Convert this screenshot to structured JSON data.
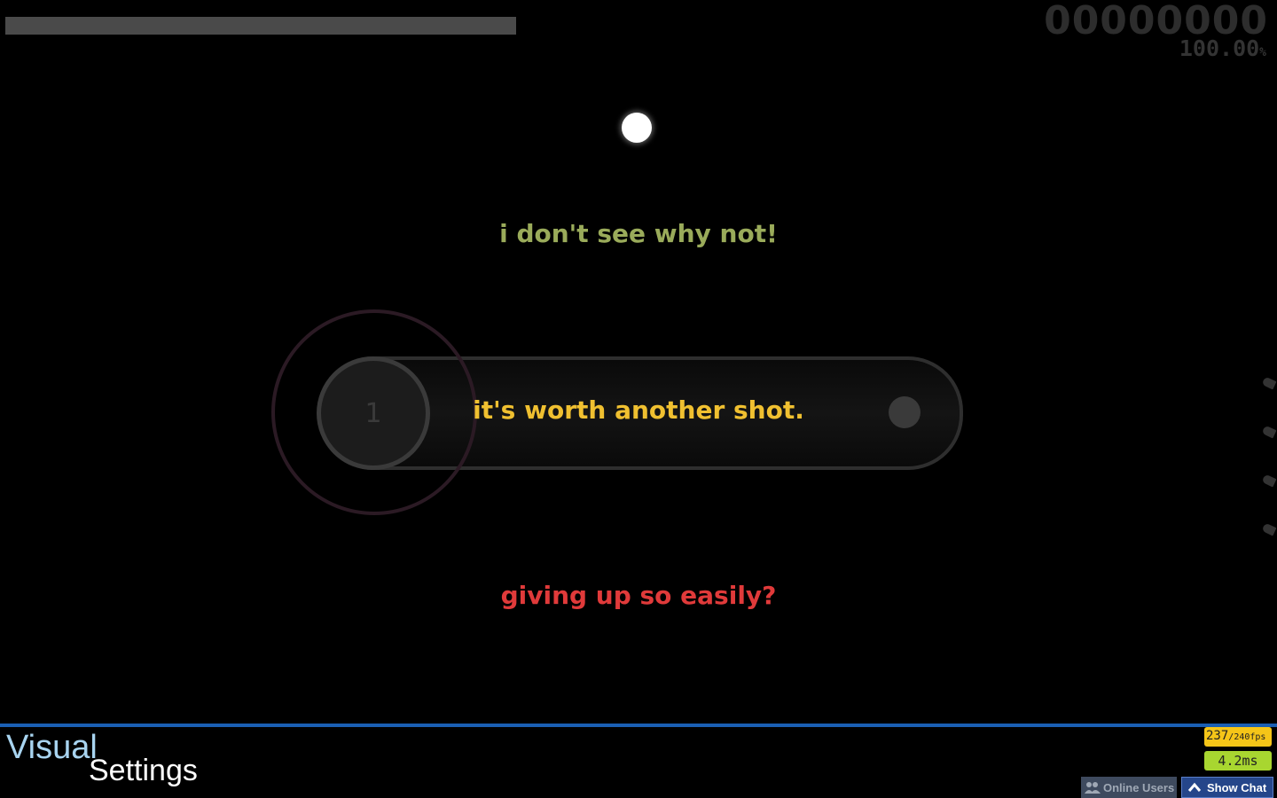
{
  "hud": {
    "score": "00000000",
    "accuracy": "100.00",
    "accuracy_unit": "%",
    "health_fraction": 1.0
  },
  "pause_menu": {
    "continue_label": "i don't see why not!",
    "retry_label": "it's worth another shot.",
    "quit_label": "giving up so easily?"
  },
  "playfield": {
    "combo_number": "1"
  },
  "overlay": {
    "visual_label": "Visual",
    "settings_label": "Settings"
  },
  "stats": {
    "fps": "237",
    "fps_target": "/240fps",
    "frame_time": "4.2ms"
  },
  "toolbar": {
    "online_users_label": "Online Users",
    "show_chat_label": "Show Chat"
  },
  "colors": {
    "continue": "#9aab5a",
    "retry": "#f0c030",
    "quit": "#e03a3a",
    "accent_line": "#1a5fb4"
  }
}
